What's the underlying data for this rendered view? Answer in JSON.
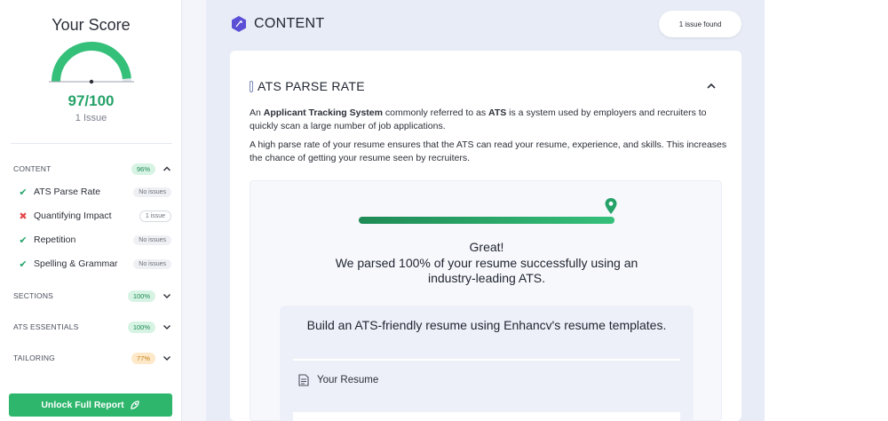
{
  "sidebar": {
    "score_title": "Your Score",
    "score_value": "97/100",
    "issue_count": "1 Issue",
    "gauge_fraction": 0.97,
    "categories": [
      {
        "label": "CONTENT",
        "percent": "96%",
        "expanded": true
      },
      {
        "label": "SECTIONS",
        "percent": "100%",
        "expanded": false
      },
      {
        "label": "ATS ESSENTIALS",
        "percent": "100%",
        "expanded": false
      },
      {
        "label": "TAILORING",
        "percent": "77%",
        "expanded": false
      }
    ],
    "content_items": [
      {
        "label": "ATS Parse Rate",
        "status": "ok",
        "badge": "No issues"
      },
      {
        "label": "Quantifying Impact",
        "status": "bad",
        "badge": "1 issue"
      },
      {
        "label": "Repetition",
        "status": "ok",
        "badge": "No issues"
      },
      {
        "label": "Spelling & Grammar",
        "status": "ok",
        "badge": "No issues"
      }
    ],
    "unlock_label": "Unlock Full Report"
  },
  "main": {
    "section_title": "CONTENT",
    "issue_pill": "1 issue found",
    "card": {
      "title": "ATS PARSE RATE",
      "para1": {
        "part1": "An ",
        "bold1": "Applicant Tracking System",
        "part2": " commonly referred to as ",
        "bold2": "ATS",
        "part3": " is a system used by employers and recruiters to quickly scan a large number of job applications."
      },
      "para2": "A high parse rate of your resume ensures that the ATS can read your resume, experience, and skills. This increases the chance of getting your resume seen by recruiters.",
      "parse_progress": 1.0,
      "great": "Great!",
      "parsed_text": "We parsed 100% of your resume successfully using an industry-leading ATS.",
      "build_text": "Build an ATS-friendly resume using Enhancv's resume templates.",
      "your_resume": "Your Resume"
    }
  },
  "colors": {
    "accent_green": "#26a269",
    "error_red": "#e5484d",
    "brand_purple": "#5b4fd6"
  }
}
